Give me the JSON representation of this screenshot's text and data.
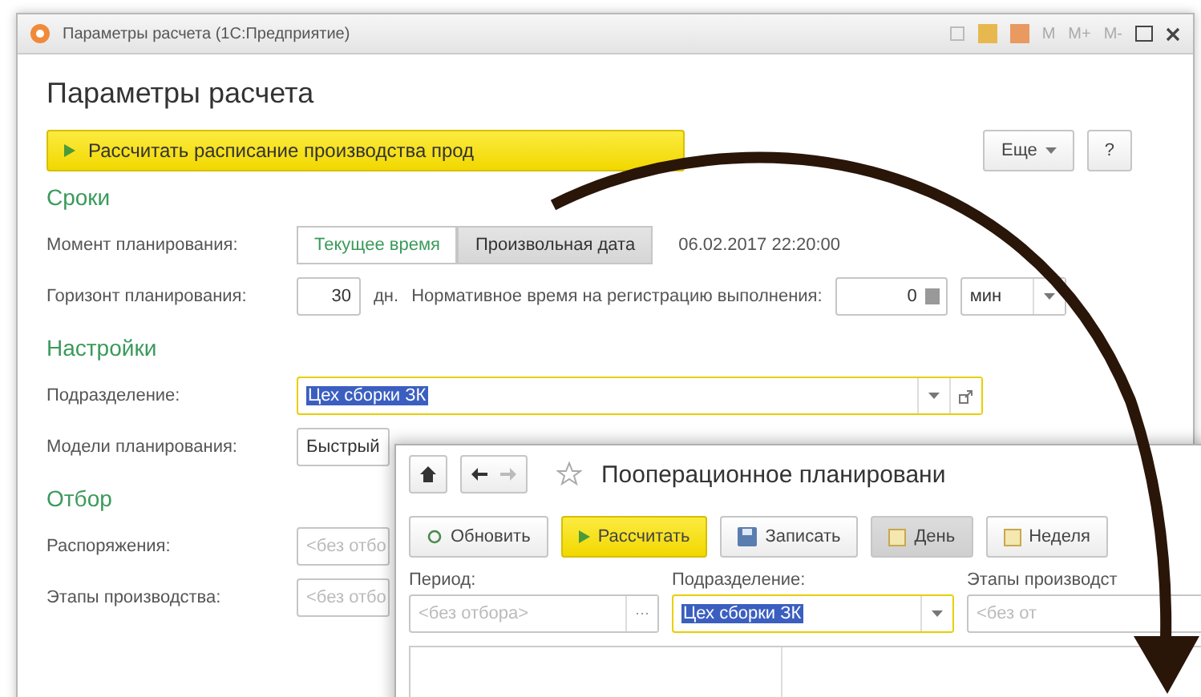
{
  "window": {
    "title": "Параметры расчета  (1С:Предприятие)",
    "memory_buttons": [
      "M",
      "M+",
      "M-"
    ]
  },
  "heading": "Параметры расчета",
  "toolbar": {
    "primary": "Рассчитать расписание производства прод",
    "more": "Еще",
    "help": "?"
  },
  "terms": {
    "title": "Сроки",
    "moment_label": "Момент планирования:",
    "options": [
      {
        "label": "Текущее время",
        "selected": false
      },
      {
        "label": "Произвольная дата",
        "selected": true
      }
    ],
    "moment_value": "06.02.2017 22:20:00",
    "horizon_label": "Горизонт планирования:",
    "horizon_value": "30",
    "horizon_unit": "дн.",
    "norm_label": "Нормативное время на регистрацию выполнения:",
    "norm_value": "0",
    "norm_unit": "мин"
  },
  "settings": {
    "title": "Настройки",
    "department_label": "Подразделение:",
    "department_value": "Цех сборки ЗК",
    "models_label": "Модели планирования:",
    "models_value": "Быстрый"
  },
  "filter": {
    "title": "Отбор",
    "fields": [
      {
        "label": "Распоряжения:",
        "placeholder": "<без отбо"
      },
      {
        "label": "Этапы производства:",
        "placeholder": "<без отбо"
      }
    ]
  },
  "planning_window": {
    "title": "Пооперационное планировани",
    "toolbar": [
      {
        "label": "Обновить",
        "kind": "refresh"
      },
      {
        "label": "Рассчитать",
        "kind": "primary"
      },
      {
        "label": "Записать",
        "kind": "save"
      },
      {
        "label": "День",
        "kind": "period",
        "selected": true
      },
      {
        "label": "Неделя",
        "kind": "period",
        "selected": false
      }
    ],
    "filters": [
      {
        "label": "Период:",
        "placeholder": "<без отбора>",
        "kind": "period"
      },
      {
        "label": "Подразделение:",
        "value": "Цех сборки ЗК",
        "kind": "select"
      },
      {
        "label": "Этапы производст",
        "placeholder": "<без от",
        "kind": "select"
      }
    ]
  }
}
